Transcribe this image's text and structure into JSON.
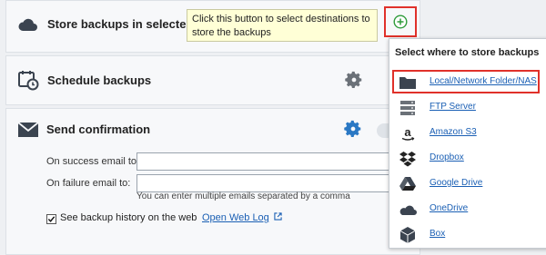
{
  "sections": {
    "store": {
      "title": "Store backups in selected des"
    },
    "schedule": {
      "title": "Schedule backups"
    },
    "confirm": {
      "title": "Send confirmation",
      "success_label": "On success email to:",
      "failure_label": "On failure email to:",
      "success_value": "",
      "failure_value": "",
      "hint": "You can enter multiple emails separated by a comma",
      "history_checked": true,
      "history_label": "See backup history on the web",
      "open_log": "Open Web Log"
    }
  },
  "tooltip": {
    "line1": "Click this button to select destinations to",
    "line2": "store the backups"
  },
  "dropdown": {
    "header": "Select where to store backups",
    "items": [
      {
        "label": "Local/Network Folder/NAS",
        "icon": "folder-icon"
      },
      {
        "label": "FTP Server",
        "icon": "server-icon"
      },
      {
        "label": "Amazon S3",
        "icon": "amazon-icon"
      },
      {
        "label": "Dropbox",
        "icon": "dropbox-icon"
      },
      {
        "label": "Google Drive",
        "icon": "google-drive-icon"
      },
      {
        "label": "OneDrive",
        "icon": "onedrive-icon"
      },
      {
        "label": "Box",
        "icon": "box-icon"
      }
    ]
  },
  "colors": {
    "accent": "#1a5fb4",
    "gear_blue": "#2a78c4",
    "gear_gray": "#6b7178",
    "highlight": "#e0312a",
    "add_green": "#2e9b3a"
  }
}
